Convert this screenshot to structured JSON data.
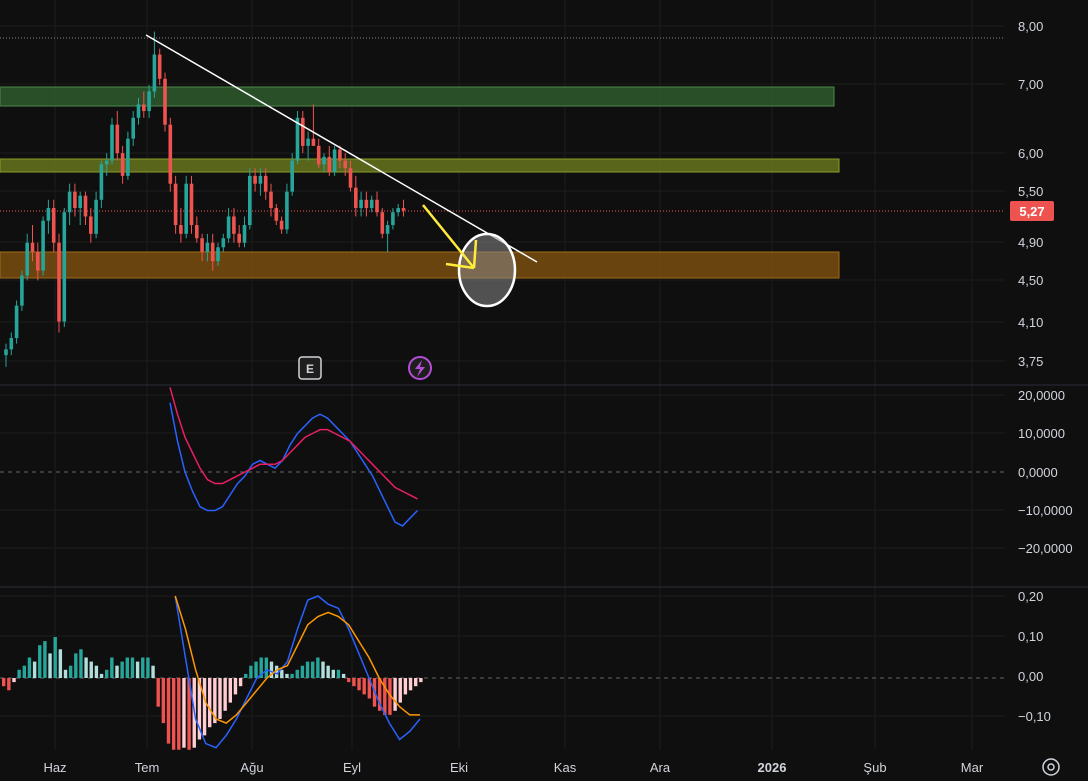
{
  "chart_data": [
    {
      "type": "candlestick",
      "pane": "price",
      "x_ticks": [
        "Haz",
        "Tem",
        "Ağu",
        "Eyl",
        "Eki",
        "Kas",
        "Ara",
        "2026",
        "Şub",
        "Mar"
      ],
      "y_ticks": [
        "8,00",
        "7,00",
        "6,00",
        "5,50",
        "4,90",
        "4,50",
        "4,10",
        "3,75"
      ],
      "y_scale": "log",
      "last_price": 5.27,
      "last_price_label": "5,27",
      "colors": {
        "up": "#26a69a",
        "down": "#ef5350",
        "background": "#0f0f0f"
      },
      "candles": [
        [
          3.8,
          3.9,
          3.7,
          3.85
        ],
        [
          3.85,
          4.0,
          3.8,
          3.95
        ],
        [
          3.95,
          4.3,
          3.9,
          4.25
        ],
        [
          4.25,
          4.6,
          4.2,
          4.55
        ],
        [
          4.55,
          5.0,
          4.5,
          4.9
        ],
        [
          4.9,
          5.1,
          4.7,
          4.8
        ],
        [
          4.8,
          4.9,
          4.5,
          4.6
        ],
        [
          4.6,
          5.2,
          4.55,
          5.15
        ],
        [
          5.15,
          5.4,
          5.0,
          5.3
        ],
        [
          5.3,
          5.4,
          4.8,
          4.9
        ],
        [
          4.9,
          5.0,
          4.0,
          4.1
        ],
        [
          4.1,
          5.3,
          4.05,
          5.25
        ],
        [
          5.25,
          5.6,
          5.1,
          5.5
        ],
        [
          5.5,
          5.6,
          5.2,
          5.3
        ],
        [
          5.3,
          5.5,
          5.1,
          5.45
        ],
        [
          5.45,
          5.5,
          5.1,
          5.2
        ],
        [
          5.2,
          5.3,
          4.9,
          5.0
        ],
        [
          5.0,
          5.5,
          4.95,
          5.4
        ],
        [
          5.4,
          5.9,
          5.3,
          5.85
        ],
        [
          5.85,
          6.0,
          5.7,
          5.9
        ],
        [
          5.9,
          6.5,
          5.85,
          6.4
        ],
        [
          6.4,
          6.6,
          5.9,
          6.0
        ],
        [
          6.0,
          6.1,
          5.6,
          5.7
        ],
        [
          5.7,
          6.3,
          5.65,
          6.2
        ],
        [
          6.2,
          6.6,
          6.1,
          6.5
        ],
        [
          6.5,
          6.8,
          6.4,
          6.7
        ],
        [
          6.7,
          6.9,
          6.5,
          6.6
        ],
        [
          6.6,
          7.0,
          6.5,
          6.9
        ],
        [
          6.9,
          7.9,
          6.8,
          7.5
        ],
        [
          7.5,
          7.6,
          7.0,
          7.1
        ],
        [
          7.1,
          7.2,
          6.3,
          6.4
        ],
        [
          6.4,
          6.5,
          5.5,
          5.6
        ],
        [
          5.6,
          5.7,
          5.0,
          5.1
        ],
        [
          5.1,
          5.3,
          4.9,
          5.0
        ],
        [
          5.0,
          5.7,
          4.95,
          5.6
        ],
        [
          5.6,
          5.7,
          5.0,
          5.1
        ],
        [
          5.1,
          5.2,
          4.9,
          4.95
        ],
        [
          4.95,
          5.0,
          4.7,
          4.8
        ],
        [
          4.8,
          5.0,
          4.7,
          4.9
        ],
        [
          4.9,
          5.0,
          4.6,
          4.7
        ],
        [
          4.7,
          4.9,
          4.65,
          4.85
        ],
        [
          4.85,
          5.0,
          4.8,
          4.95
        ],
        [
          4.95,
          5.3,
          4.9,
          5.2
        ],
        [
          5.2,
          5.3,
          4.9,
          5.0
        ],
        [
          5.0,
          5.1,
          4.85,
          4.9
        ],
        [
          4.9,
          5.2,
          4.85,
          5.1
        ],
        [
          5.1,
          5.8,
          5.05,
          5.7
        ],
        [
          5.7,
          5.8,
          5.5,
          5.6
        ],
        [
          5.6,
          5.8,
          5.45,
          5.7
        ],
        [
          5.7,
          5.8,
          5.4,
          5.5
        ],
        [
          5.5,
          5.6,
          5.2,
          5.3
        ],
        [
          5.3,
          5.35,
          5.1,
          5.15
        ],
        [
          5.15,
          5.2,
          5.0,
          5.05
        ],
        [
          5.05,
          5.6,
          5.0,
          5.5
        ],
        [
          5.5,
          6.0,
          5.45,
          5.9
        ],
        [
          5.9,
          6.6,
          5.85,
          6.5
        ],
        [
          6.5,
          6.6,
          6.0,
          6.1
        ],
        [
          6.1,
          6.3,
          5.9,
          6.2
        ],
        [
          6.2,
          6.7,
          6.1,
          6.1
        ],
        [
          6.1,
          6.2,
          5.8,
          5.85
        ],
        [
          5.85,
          6.0,
          5.75,
          5.95
        ],
        [
          5.95,
          6.1,
          5.7,
          5.75
        ],
        [
          5.75,
          6.1,
          5.7,
          6.05
        ],
        [
          6.05,
          6.1,
          5.8,
          5.9
        ],
        [
          5.9,
          6.0,
          5.7,
          5.8
        ],
        [
          5.8,
          5.9,
          5.5,
          5.55
        ],
        [
          5.55,
          5.7,
          5.2,
          5.3
        ],
        [
          5.3,
          5.5,
          5.2,
          5.4
        ],
        [
          5.4,
          5.5,
          5.2,
          5.3
        ],
        [
          5.3,
          5.45,
          5.25,
          5.4
        ],
        [
          5.4,
          5.5,
          5.2,
          5.25
        ],
        [
          5.25,
          5.3,
          4.95,
          5.0
        ],
        [
          5.0,
          5.15,
          4.8,
          5.1
        ],
        [
          5.1,
          5.3,
          5.05,
          5.25
        ],
        [
          5.25,
          5.35,
          5.2,
          5.3
        ],
        [
          5.3,
          5.4,
          5.2,
          5.27
        ]
      ]
    },
    {
      "type": "line",
      "pane": "oscillator-1",
      "y_ticks": [
        "20,0000",
        "10,0000",
        "0,0000",
        "−10,0000",
        "−20,0000"
      ],
      "ylim": [
        -25,
        25
      ],
      "series": [
        {
          "color": "#2962ff",
          "values": [
            40,
            28,
            18,
            8,
            0,
            -5,
            -9,
            -10,
            -10,
            -9,
            -6,
            -3,
            -1,
            2,
            3,
            2,
            1,
            3,
            7,
            10,
            12,
            14,
            15,
            14,
            12,
            10,
            8,
            5,
            2,
            -1,
            -5,
            -9,
            -13,
            -14,
            -12,
            -10
          ]
        },
        {
          "color": "#e91e63",
          "values": [
            38,
            30,
            22,
            15,
            9,
            5,
            1,
            -2,
            -3,
            -3,
            -2,
            -1,
            0,
            1,
            2,
            2,
            2,
            3,
            5,
            7,
            9,
            10,
            11,
            11,
            10,
            9,
            8,
            6,
            4,
            2,
            0,
            -2,
            -4,
            -5,
            -6,
            -7
          ]
        }
      ]
    },
    {
      "type": "histogram-line",
      "pane": "oscillator-2",
      "y_ticks": [
        "0,20",
        "0,10",
        "0,00",
        "−0,10"
      ],
      "ylim": [
        -0.18,
        0.21
      ],
      "histogram": [
        -0.02,
        -0.03,
        -0.01,
        0.02,
        0.03,
        0.05,
        0.04,
        0.08,
        0.09,
        0.06,
        0.1,
        0.07,
        0.02,
        0.03,
        0.06,
        0.07,
        0.05,
        0.04,
        0.03,
        0.01,
        0.02,
        0.05,
        0.03,
        0.04,
        0.05,
        0.05,
        0.04,
        0.05,
        0.05,
        0.03,
        -0.07,
        -0.11,
        -0.16,
        -0.18,
        -0.18,
        -0.17,
        -0.18,
        -0.17,
        -0.15,
        -0.14,
        -0.12,
        -0.11,
        -0.1,
        -0.08,
        -0.06,
        -0.04,
        -0.02,
        0.01,
        0.03,
        0.04,
        0.05,
        0.05,
        0.04,
        0.03,
        0.02,
        0.01,
        0.01,
        0.02,
        0.03,
        0.04,
        0.04,
        0.05,
        0.04,
        0.03,
        0.02,
        0.02,
        0.01,
        -0.01,
        -0.02,
        -0.03,
        -0.04,
        -0.05,
        -0.07,
        -0.08,
        -0.09,
        -0.09,
        -0.08,
        -0.06,
        -0.04,
        -0.03,
        -0.02,
        -0.01
      ],
      "series": [
        {
          "color": "#2962ff",
          "values": [
            0.3,
            0.2,
            0.05,
            -0.1,
            -0.16,
            -0.17,
            -0.14,
            -0.1,
            -0.05,
            0.0,
            0.02,
            0.01,
            0.04,
            0.12,
            0.19,
            0.2,
            0.18,
            0.17,
            0.12,
            0.06,
            0.0,
            -0.06,
            -0.11,
            -0.15,
            -0.13,
            -0.1
          ]
        },
        {
          "color": "#ff9800",
          "values": [
            0.25,
            0.2,
            0.12,
            0.02,
            -0.06,
            -0.1,
            -0.11,
            -0.09,
            -0.06,
            -0.03,
            0.0,
            0.02,
            0.03,
            0.08,
            0.13,
            0.15,
            0.16,
            0.15,
            0.13,
            0.09,
            0.05,
            0.0,
            -0.04,
            -0.07,
            -0.09,
            -0.09
          ]
        }
      ]
    }
  ],
  "badges": {
    "earnings_letter": "E"
  },
  "icons": {
    "earnings": "earnings-icon",
    "dividend": "lightning-icon",
    "settings": "settings-icon"
  }
}
